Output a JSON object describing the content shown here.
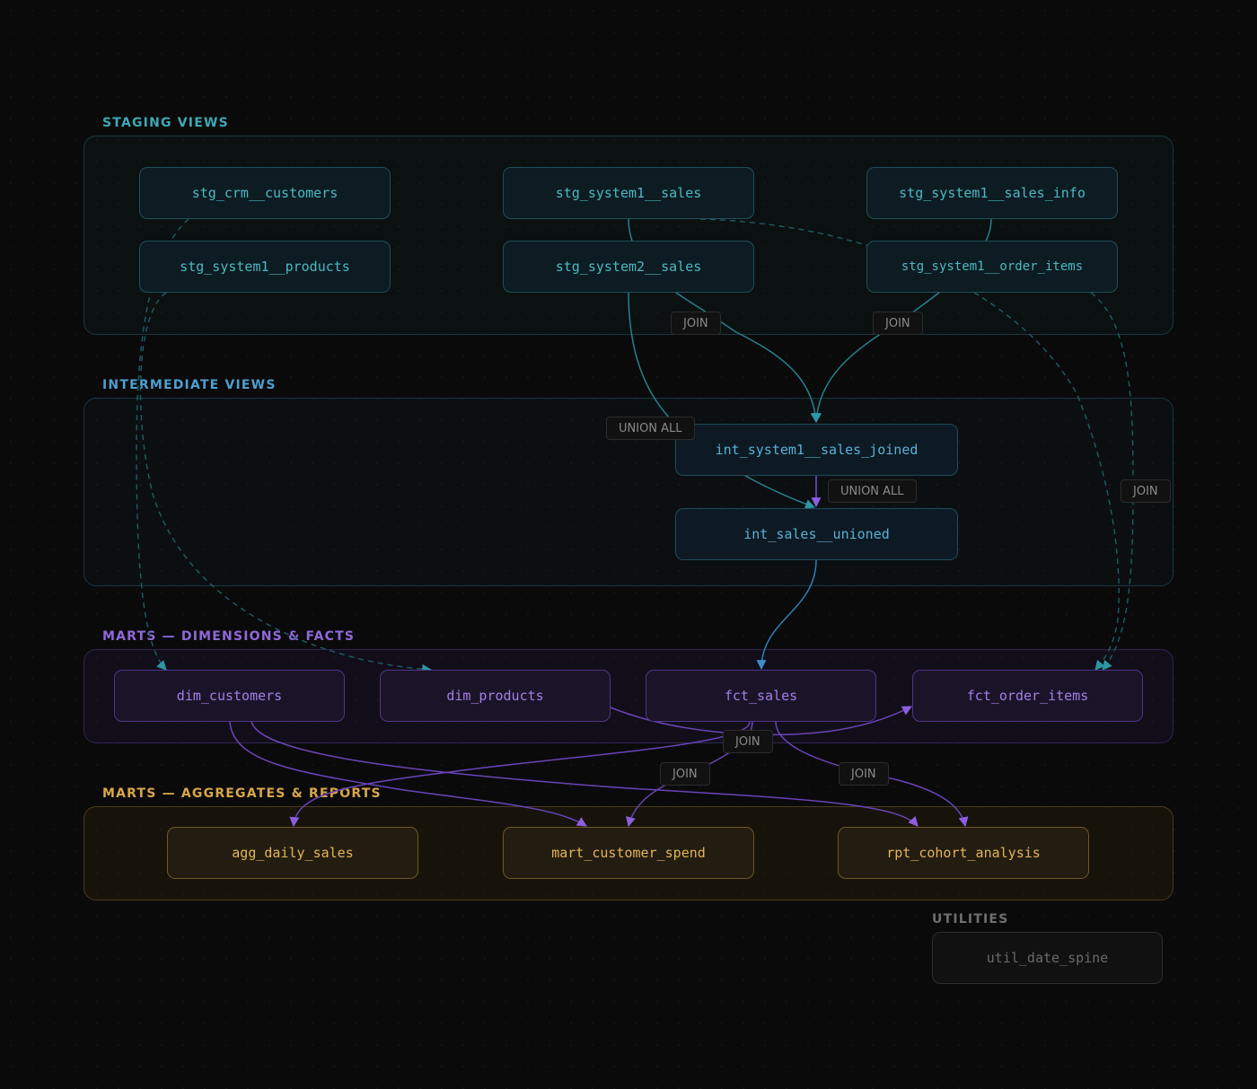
{
  "colors": {
    "staging": "#4cb8c2",
    "intermediate": "#5ab0d6",
    "marts_dims_facts": "#a47ee8",
    "marts_aggregates": "#e2b45a",
    "utilities": "#6a6a6a"
  },
  "groups": {
    "staging": {
      "label": "STAGING VIEWS"
    },
    "intermediate": {
      "label": "INTERMEDIATE VIEWS"
    },
    "marts_facts": {
      "label": "MARTS — DIMENSIONS & FACTS"
    },
    "marts_agg": {
      "label": "MARTS — AGGREGATES & REPORTS"
    },
    "utilities": {
      "label": "UTILITIES"
    }
  },
  "nodes": {
    "stg_crm_customers": "stg_crm__customers",
    "stg_system1_sales": "stg_system1__sales",
    "stg_system1_sales_info": "stg_system1__sales_info",
    "stg_system1_products": "stg_system1__products",
    "stg_system2_sales": "stg_system2__sales",
    "stg_system1_order_items": "stg_system1__order_items",
    "int_system1_sales_joined": "int_system1__sales_joined",
    "int_sales_unioned": "int_sales__unioned",
    "dim_customers": "dim_customers",
    "dim_products": "dim_products",
    "fct_sales": "fct_sales",
    "fct_order_items": "fct_order_items",
    "agg_daily_sales": "agg_daily_sales",
    "mart_customer_spend": "mart_customer_spend",
    "rpt_cohort_analysis": "rpt_cohort_analysis",
    "util_date_spine": "util_date_spine"
  },
  "edge_labels": {
    "join_stg_sales": "JOIN",
    "join_stg_sales_info": "JOIN",
    "union_all_stg2": "UNION ALL",
    "union_all_int": "UNION ALL",
    "join_order_items": "JOIN",
    "join_fct_order_items": "JOIN",
    "join_fct_mart": "JOIN",
    "join_fct_rpt": "JOIN"
  }
}
